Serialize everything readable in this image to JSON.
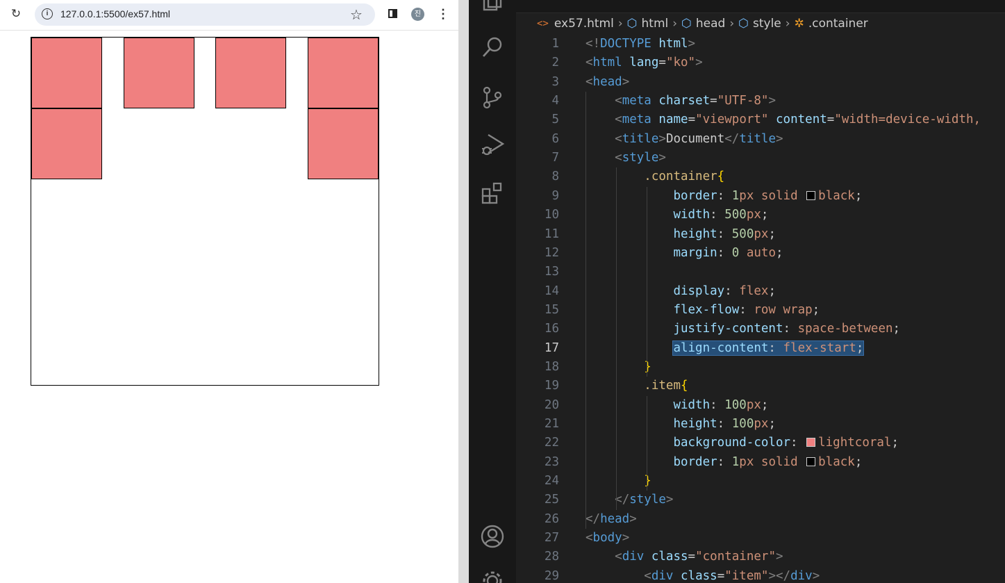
{
  "browser": {
    "url": "127.0.0.1:5500/ex57.html",
    "profile_initial": "진",
    "items_count": 6
  },
  "editor": {
    "breadcrumb": [
      "ex57.html",
      "html",
      "head",
      "style",
      ".container"
    ],
    "active_line": 17,
    "lines": [
      "<!DOCTYPE html>",
      "<html lang=\"ko\">",
      "<head>",
      "    <meta charset=\"UTF-8\">",
      "    <meta name=\"viewport\" content=\"width=device-width,",
      "    <title>Document</title>",
      "    <style>",
      "        .container{",
      "            border: 1px solid black;",
      "            width: 500px;",
      "            height: 500px;",
      "            margin: 0 auto;",
      "",
      "            display: flex;",
      "            flex-flow: row wrap;",
      "            justify-content: space-between;",
      "            align-content: flex-start;",
      "        }",
      "        .item{",
      "            width: 100px;",
      "            height: 100px;",
      "            background-color: lightcoral;",
      "            border: 1px solid black;",
      "        }",
      "    </style>",
      "</head>",
      "<body>",
      "    <div class=\"container\">",
      "        <div class=\"item\"></div>"
    ]
  },
  "colors": {
    "item": "#f08080",
    "selection": "#264f78"
  }
}
